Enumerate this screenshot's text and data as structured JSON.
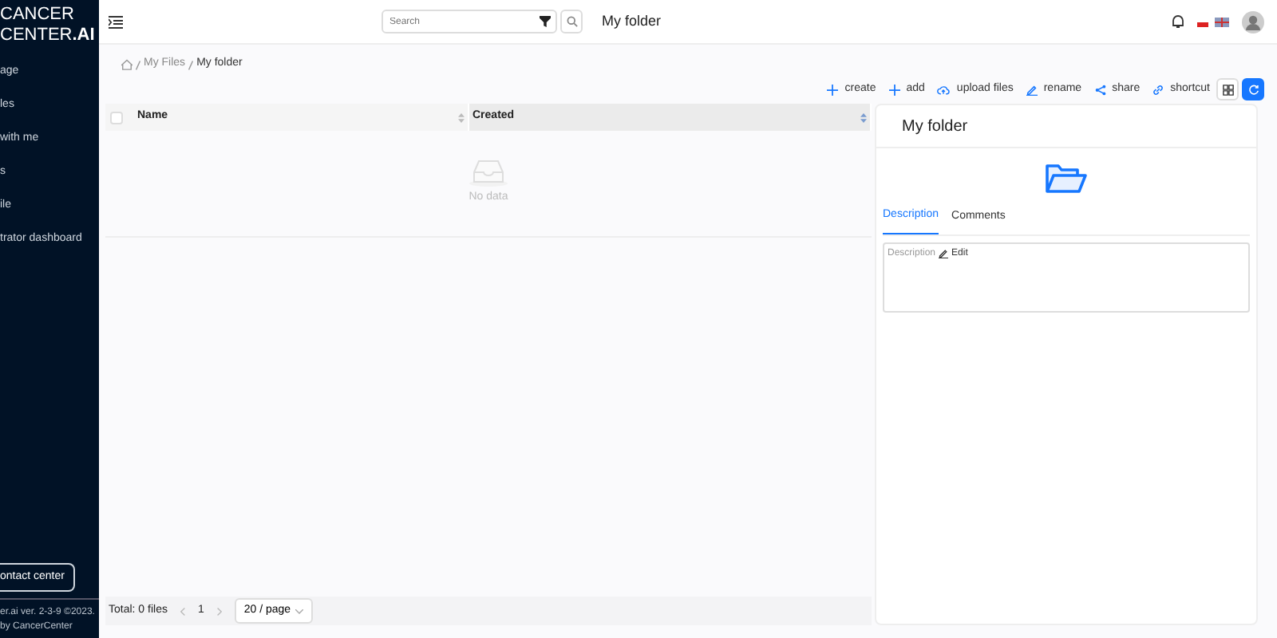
{
  "sidebar": {
    "logo_line_1": "CANCER",
    "logo_line_2": "CENTER**.AI**",
    "items": [
      {
        "label": "age"
      },
      {
        "label": "les"
      },
      {
        "label": "with me"
      },
      {
        "label": "s"
      },
      {
        "label": "ile"
      },
      {
        "label": "trator dashboard"
      }
    ],
    "contact_button": "ontact center",
    "footer_text": "er.ai ver. 2-3-9 ©2023.",
    "footer_by": "by",
    "footer_link": "CancerCenter"
  },
  "header": {
    "search": {
      "placeholder": "Search"
    },
    "title": "My folder"
  },
  "breadcrumb": [
    "My Files",
    "My folder"
  ],
  "toolbar": [
    {
      "kind": "plus",
      "label": "create"
    },
    {
      "kind": "plus",
      "label": "add"
    },
    {
      "kind": "upload",
      "label": "upload files"
    },
    {
      "kind": "edit",
      "label": "rename"
    },
    {
      "kind": "share",
      "label": "share"
    },
    {
      "kind": "link",
      "label": "shortcut"
    }
  ],
  "table": {
    "select_all_checked": false,
    "columns": [
      "Name",
      "Created"
    ],
    "empty_text": "No data"
  },
  "pagination": {
    "total": "Total: 0 files",
    "page": "1",
    "page_size": "20 / page"
  },
  "panel": {
    "title": "My folder",
    "tabs": [
      {
        "label": "Description",
        "selected": true
      },
      {
        "label": "Comments",
        "selected": false
      }
    ],
    "description_label": "Description",
    "edit": "Edit"
  }
}
